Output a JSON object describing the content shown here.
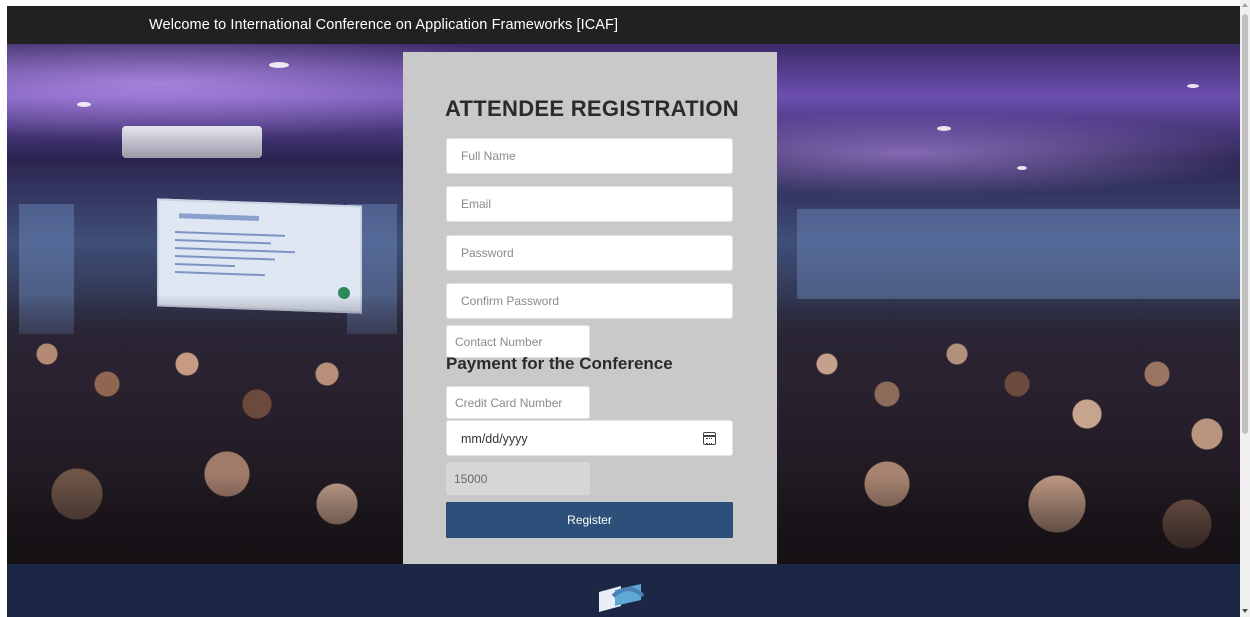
{
  "navbar": {
    "title": "Welcome to International Conference on Application Frameworks [ICAF]"
  },
  "form": {
    "heading": "ATTENDEE REGISTRATION",
    "full_name_placeholder": "Full Name",
    "email_placeholder": "Email",
    "password_placeholder": "Password",
    "confirm_password_placeholder": "Confirm Password",
    "contact_number_placeholder": "Contact Number",
    "payment_heading": "Payment for the Conference",
    "credit_card_placeholder": "Credit Card Number",
    "date_placeholder": "mm/dd/yyyy",
    "amount_value": "15000",
    "register_label": "Register"
  },
  "icons": {
    "date_picker": "calendar-icon",
    "footer_logo": "logo-icon"
  },
  "colors": {
    "navbar_bg": "#212121",
    "card_bg": "#c9c9c9",
    "button_bg": "#2c5079",
    "footer_bg": "#1c2645"
  }
}
